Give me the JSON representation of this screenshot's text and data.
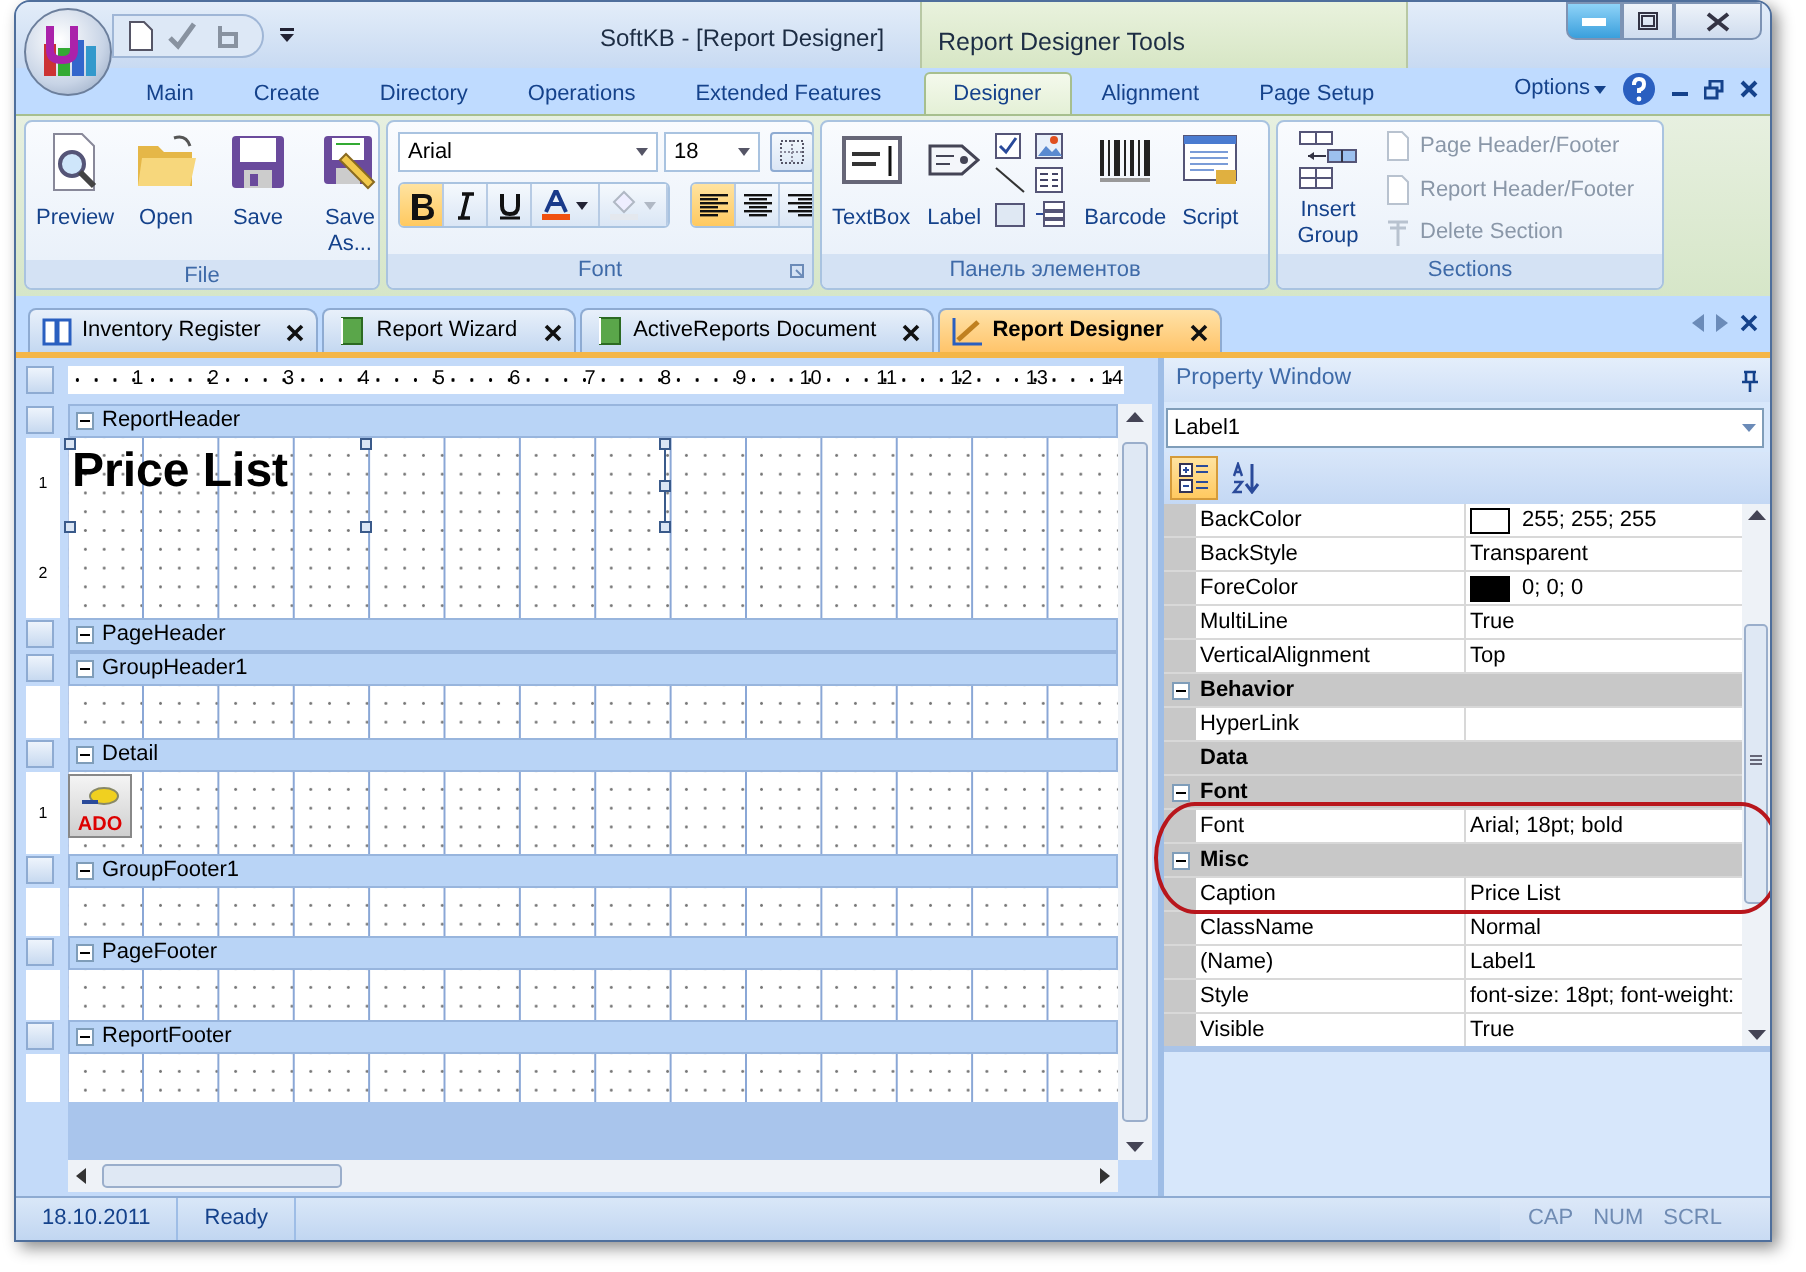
{
  "window": {
    "title": "SoftKB - [Report Designer]",
    "contextual_title": "Report Designer Tools"
  },
  "ribbon_tabs": [
    {
      "label": "Main",
      "selected": false
    },
    {
      "label": "Create",
      "selected": false
    },
    {
      "label": "Directory",
      "selected": false
    },
    {
      "label": "Operations",
      "selected": false
    },
    {
      "label": "Extended Features",
      "selected": false
    },
    {
      "label": "Designer",
      "selected": true
    },
    {
      "label": "Alignment",
      "selected": false
    },
    {
      "label": "Page Setup",
      "selected": false
    }
  ],
  "options_menu": "Options",
  "file_group": {
    "label": "File",
    "buttons": [
      "Preview",
      "Open",
      "Save",
      "Save As..."
    ]
  },
  "font_group": {
    "label": "Font",
    "font_name": "Arial",
    "font_size": "18",
    "format_buttons": [
      {
        "kind": "bold",
        "selected": true
      },
      {
        "kind": "italic",
        "selected": false
      },
      {
        "kind": "underline",
        "selected": false
      }
    ],
    "color_buttons": [
      {
        "kind": "font-color",
        "disabled": false
      },
      {
        "kind": "fill-color",
        "disabled": true
      }
    ],
    "align_buttons": [
      {
        "kind": "left",
        "selected": true
      },
      {
        "kind": "center",
        "selected": false
      },
      {
        "kind": "right",
        "selected": false
      }
    ]
  },
  "elements_group": {
    "label": "Панель элементов",
    "buttons": [
      "TextBox",
      "Label",
      "Barcode",
      "Script"
    ]
  },
  "sections_group": {
    "label": "Sections",
    "insert_button": "Insert Group",
    "items": [
      {
        "label": "Page Header/Footer",
        "disabled": true
      },
      {
        "label": "Report Header/Footer",
        "disabled": true
      },
      {
        "label": "Delete Section",
        "disabled": true
      }
    ]
  },
  "doc_tabs": [
    {
      "label": "Inventory Register",
      "selected": false
    },
    {
      "label": "Report Wizard",
      "selected": false
    },
    {
      "label": "ActiveReports Document",
      "selected": false
    },
    {
      "label": "Report Designer",
      "selected": true
    }
  ],
  "designer": {
    "ruler": [
      "1",
      "2",
      "3",
      "4",
      "5",
      "6",
      "7",
      "8",
      "9",
      "10",
      "11",
      "12",
      "13",
      "14"
    ],
    "sections": [
      {
        "name": "ReportHeader",
        "ruler_marks": [
          "1",
          "2"
        ],
        "controls": [
          {
            "kind": "label",
            "text": "Price List",
            "selected": true
          }
        ]
      },
      {
        "name": "PageHeader"
      },
      {
        "name": "GroupHeader1"
      },
      {
        "name": "Detail",
        "ruler_marks": [
          "1"
        ],
        "controls": [
          {
            "kind": "data-source",
            "text": "ADO"
          }
        ]
      },
      {
        "name": "GroupFooter1"
      },
      {
        "name": "PageFooter"
      },
      {
        "name": "ReportFooter"
      }
    ]
  },
  "property_window": {
    "title": "Property Window",
    "object": "Label1",
    "sort_buttons": [
      {
        "kind": "categorized",
        "selected": true
      },
      {
        "kind": "alphabetical",
        "selected": false
      }
    ],
    "rows": [
      {
        "kind": "property",
        "name": "BackColor",
        "value": "255; 255; 255",
        "color": "#ffffff"
      },
      {
        "kind": "property",
        "name": "BackStyle",
        "value": "Transparent"
      },
      {
        "kind": "property",
        "name": "ForeColor",
        "value": "0; 0; 0",
        "color": "#000000"
      },
      {
        "kind": "property",
        "name": "MultiLine",
        "value": "True"
      },
      {
        "kind": "property",
        "name": "VerticalAlignment",
        "value": "Top"
      },
      {
        "kind": "category",
        "name": "Behavior",
        "expanded": true
      },
      {
        "kind": "property",
        "name": "HyperLink"
      },
      {
        "kind": "category",
        "name": "Data"
      },
      {
        "kind": "category",
        "name": "Font",
        "expanded": true
      },
      {
        "kind": "property",
        "name": "Font",
        "value": "Arial; 18pt; bold",
        "highlighted": true
      },
      {
        "kind": "category",
        "name": "Misc",
        "expanded": true,
        "highlighted": true
      },
      {
        "kind": "property",
        "name": "Caption",
        "value": "Price List",
        "highlighted": true
      },
      {
        "kind": "property",
        "name": "ClassName",
        "value": "Normal"
      },
      {
        "kind": "property",
        "name": "(Name)",
        "value": "Label1"
      },
      {
        "kind": "property",
        "name": "Style",
        "value": "font-size: 18pt; font-weight:"
      },
      {
        "kind": "property",
        "name": "Visible",
        "value": "True"
      }
    ]
  },
  "status_bar": {
    "date": "18.10.2011",
    "status": "Ready",
    "indicators": [
      {
        "label": "CAP",
        "on": false
      },
      {
        "label": "NUM",
        "on": false
      },
      {
        "label": "SCRL",
        "on": false
      }
    ]
  }
}
